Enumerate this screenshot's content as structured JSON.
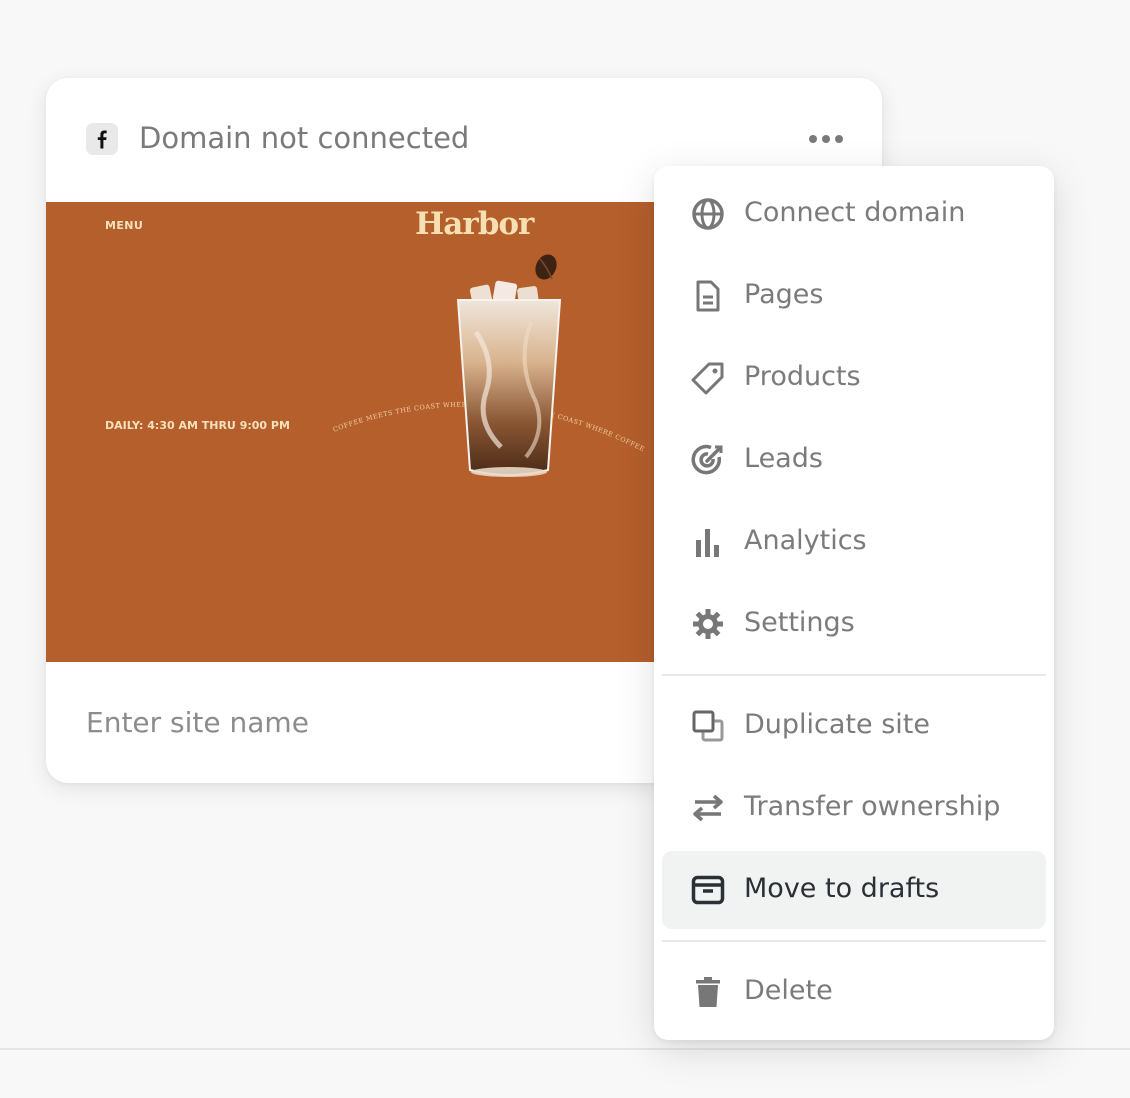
{
  "card": {
    "domain_status": "Domain not connected",
    "site_name_placeholder": "Enter site name",
    "preview": {
      "menu_label": "MENU",
      "logo_text": "Harbor",
      "hours": "DAILY: 4:30 AM THRU 9:00 PM",
      "curved_tagline": "COFFEE MEETS THE COAST WHERE COFFEE MEETS THE COAST WHERE COFFEE MEETS",
      "background_color": "#b55f2c"
    }
  },
  "menu": {
    "items": [
      {
        "label": "Connect domain",
        "icon": "globe-icon"
      },
      {
        "label": "Pages",
        "icon": "page-icon"
      },
      {
        "label": "Products",
        "icon": "tag-icon"
      },
      {
        "label": "Leads",
        "icon": "target-icon"
      },
      {
        "label": "Analytics",
        "icon": "bar-chart-icon"
      },
      {
        "label": "Settings",
        "icon": "gear-icon"
      },
      {
        "label": "Duplicate site",
        "icon": "duplicate-icon"
      },
      {
        "label": "Transfer ownership",
        "icon": "transfer-icon"
      },
      {
        "label": "Move to drafts",
        "icon": "archive-icon",
        "highlighted": true
      },
      {
        "label": "Delete",
        "icon": "trash-icon"
      }
    ]
  }
}
